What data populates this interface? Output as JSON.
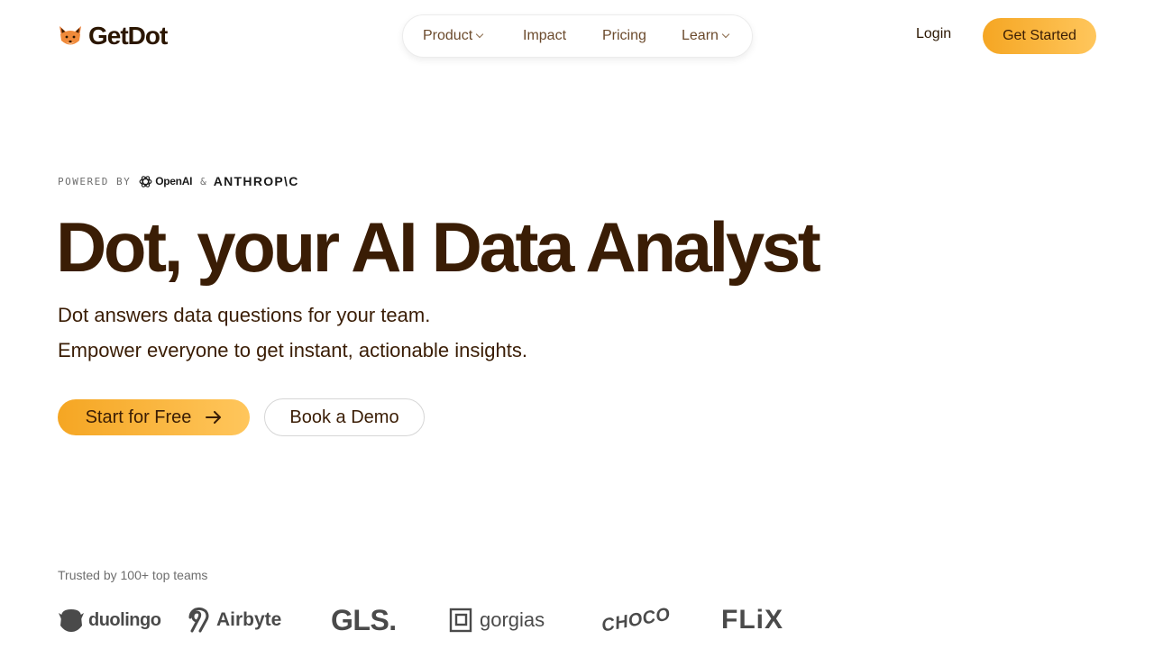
{
  "header": {
    "brand": "GetDot",
    "logo_icon": "fox-icon",
    "nav": [
      {
        "label": "Product",
        "has_dropdown": true
      },
      {
        "label": "Impact",
        "has_dropdown": false
      },
      {
        "label": "Pricing",
        "has_dropdown": false
      },
      {
        "label": "Learn",
        "has_dropdown": true
      }
    ],
    "login_label": "Login",
    "cta_label": "Get Started"
  },
  "hero": {
    "powered_by": "POWERED BY",
    "partner_1": "OpenAI",
    "ampersand": "&",
    "partner_2": "ANTHROP\\C",
    "headline": "Dot, your AI Data Analyst",
    "subline_1": "Dot answers data questions for your team.",
    "subline_2": "Empower everyone to get instant, actionable insights.",
    "primary_button": "Start for Free",
    "secondary_button": "Book a Demo"
  },
  "trusted": {
    "label": "Trusted by 100+ top teams",
    "logos": [
      "duolingo",
      "Airbyte",
      "GLS.",
      "gorgias",
      "CHOCO",
      "FLiX"
    ]
  },
  "colors": {
    "accent_start": "#f5a623",
    "accent_end": "#ffc65c",
    "text_primary": "#3a1d05",
    "text_muted": "#6e6e6e"
  }
}
